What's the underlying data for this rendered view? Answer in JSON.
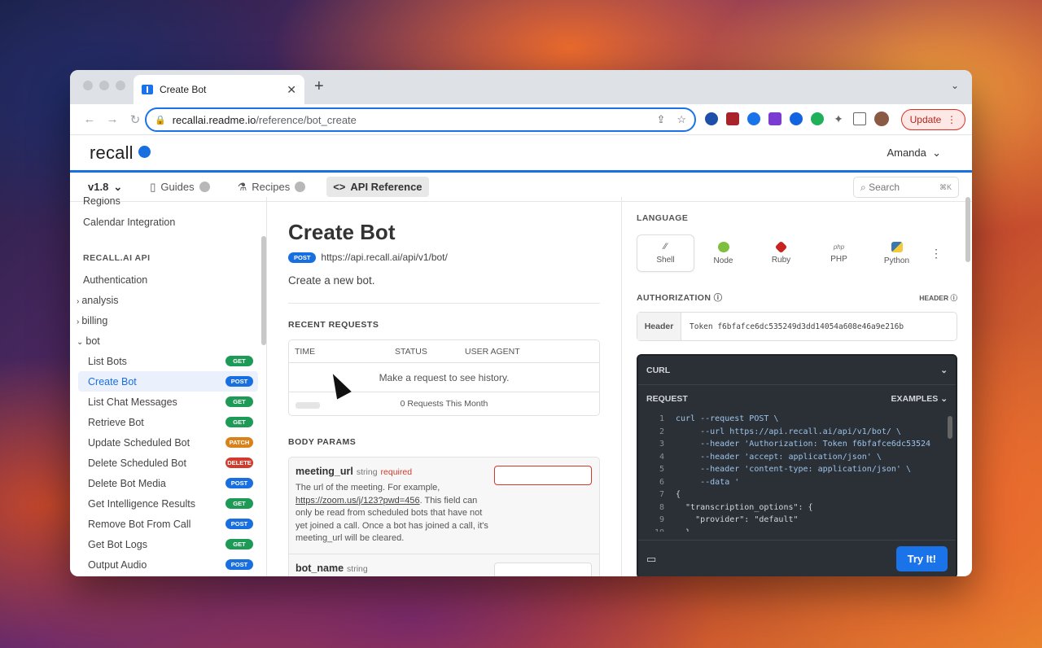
{
  "browser": {
    "tab_title": "Create Bot",
    "url_host": "recallai.readme.io",
    "url_path": "/reference/bot_create",
    "update_label": "Update",
    "ext_badge": "19"
  },
  "site": {
    "logo": "recall",
    "user": "Amanda",
    "version": "v1.8",
    "nav": [
      "Guides",
      "Recipes",
      "API Reference"
    ],
    "search_placeholder": "Search",
    "search_shortcut": "⌘K"
  },
  "sidebar": {
    "top_items": [
      "Regions",
      "Calendar Integration"
    ],
    "section": "RECALL.AI API",
    "auth": "Authentication",
    "groups": [
      "analysis",
      "billing",
      "bot"
    ],
    "items": [
      {
        "label": "List Bots",
        "method": "GET"
      },
      {
        "label": "Create Bot",
        "method": "POST"
      },
      {
        "label": "List Chat Messages",
        "method": "GET"
      },
      {
        "label": "Retrieve Bot",
        "method": "GET"
      },
      {
        "label": "Update Scheduled Bot",
        "method": "PATCH"
      },
      {
        "label": "Delete Scheduled Bot",
        "method": "DELETE"
      },
      {
        "label": "Delete Bot Media",
        "method": "POST"
      },
      {
        "label": "Get Intelligence Results",
        "method": "GET"
      },
      {
        "label": "Remove Bot From Call",
        "method": "POST"
      },
      {
        "label": "Get Bot Logs",
        "method": "GET"
      },
      {
        "label": "Output Audio",
        "method": "POST"
      }
    ]
  },
  "main": {
    "title": "Create Bot",
    "method": "POST",
    "endpoint": "https://api.recall.ai/api/v1/bot/",
    "description": "Create a new bot.",
    "recent_title": "RECENT REQUESTS",
    "cols": [
      "TIME",
      "STATUS",
      "USER AGENT"
    ],
    "empty": "Make a request to see history.",
    "count": "0 Requests This Month",
    "body_title": "BODY PARAMS",
    "p1_name": "meeting_url",
    "p1_type": "string",
    "p1_req": "required",
    "p1_desc_a": "The url of the meeting. For example,",
    "p1_link": "https://zoom.us/j/123?pwd=456",
    "p1_desc_b": ". This field can only be read from scheduled bots that have not yet joined a call. Once a bot has joined a call, it's meeting_url will be cleared.",
    "p2_name": "bot_name",
    "p2_type": "string"
  },
  "right": {
    "language_label": "LANGUAGE",
    "languages": [
      "Shell",
      "Node",
      "Ruby",
      "PHP",
      "Python"
    ],
    "auth_label": "AUTHORIZATION",
    "header_label": "HEADER",
    "header_key": "Header",
    "token": "Token f6bfafce6dc535249d3dd14054a608e46a9e216b",
    "curl_label": "CURL",
    "request_label": "REQUEST",
    "examples_label": "EXAMPLES",
    "try_label": "Try It!",
    "code": [
      "curl --request POST \\",
      "     --url https://api.recall.ai/api/v1/bot/ \\",
      "     --header 'Authorization: Token f6bfafce6dc53524",
      "     --header 'accept: application/json' \\",
      "     --header 'content-type: application/json' \\",
      "     --data '",
      "{",
      "  \"transcription_options\": {",
      "    \"provider\": \"default\"",
      "  },"
    ]
  }
}
